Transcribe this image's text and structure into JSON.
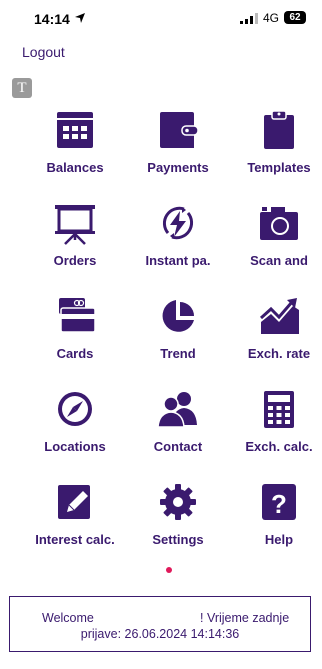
{
  "status_bar": {
    "time": "14:14",
    "network": "4G",
    "battery": "62"
  },
  "header": {
    "logout_label": "Logout",
    "badge_letter": "T"
  },
  "colors": {
    "primary": "#3a1a6e",
    "dot": "#e0195a"
  },
  "menu": [
    {
      "label": "Balances",
      "icon": "calendar-icon"
    },
    {
      "label": "Payments",
      "icon": "wallet-icon"
    },
    {
      "label": "Templates",
      "icon": "clipboard-icon"
    },
    {
      "label": "Orders",
      "icon": "presentation-board-icon"
    },
    {
      "label": "Instant pa.",
      "icon": "lightning-icon"
    },
    {
      "label": "Scan and",
      "icon": "camera-icon"
    },
    {
      "label": "Cards",
      "icon": "cards-icon"
    },
    {
      "label": "Trend",
      "icon": "pie-chart-icon"
    },
    {
      "label": "Exch. rate",
      "icon": "line-chart-icon"
    },
    {
      "label": "Locations",
      "icon": "compass-icon"
    },
    {
      "label": "Contact",
      "icon": "people-icon"
    },
    {
      "label": "Exch. calc.",
      "icon": "calculator-icon"
    },
    {
      "label": "Interest calc.",
      "icon": "edit-icon"
    },
    {
      "label": "Settings",
      "icon": "gear-icon"
    },
    {
      "label": "Help",
      "icon": "help-icon"
    }
  ],
  "footer": {
    "welcome": "Welcome",
    "last_login_prefix": "! Vrijeme zadnje",
    "last_login": "prijave: 26.06.2024 14:14:36"
  }
}
